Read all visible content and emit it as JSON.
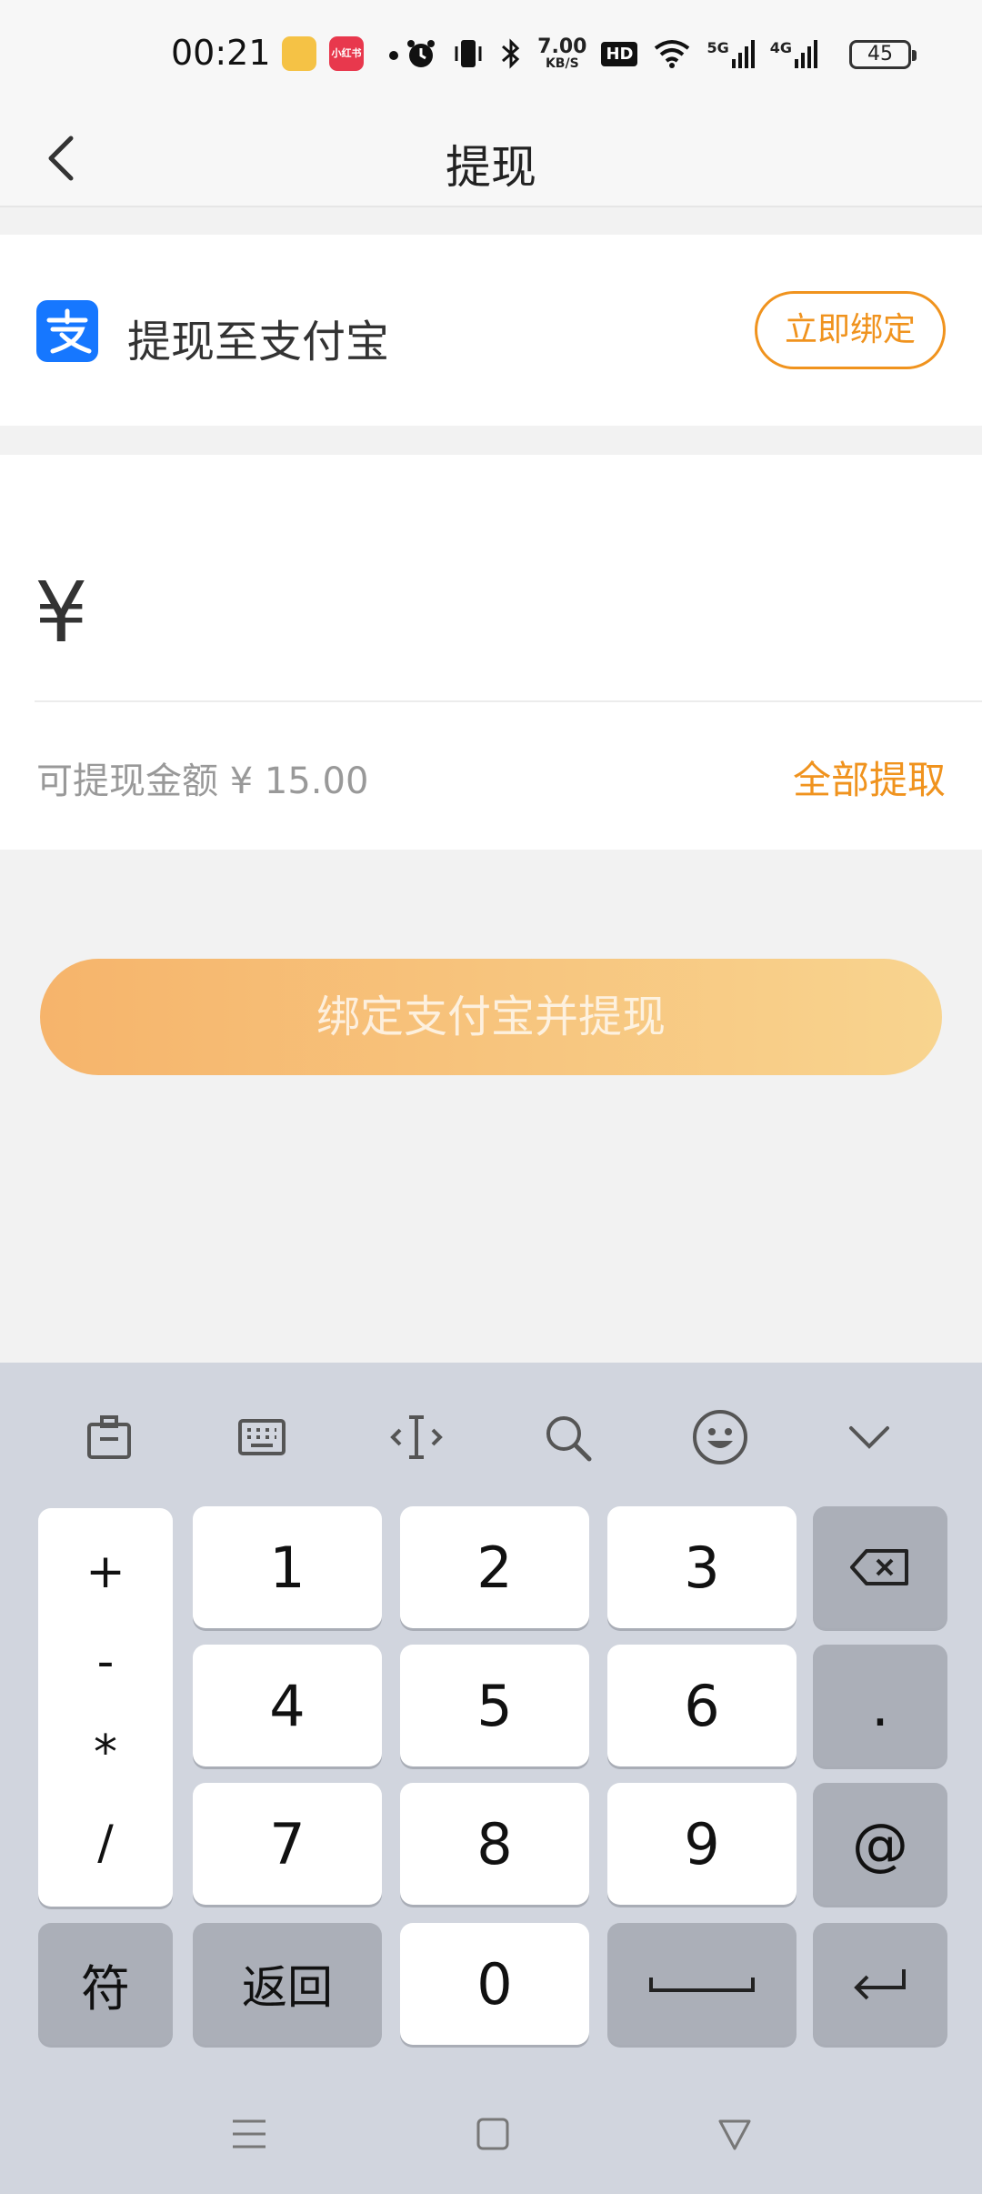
{
  "status_bar": {
    "time": "00:21",
    "xhs_label": "小红书",
    "speed_value": "7.00",
    "speed_unit": "KB/S",
    "hd_label": "HD",
    "net_5g": "5G",
    "net_4g": "4G",
    "battery": "45"
  },
  "header": {
    "title": "提现",
    "back_icon": "chevron-left-icon"
  },
  "alipay": {
    "label": "提现至支付宝",
    "bind_button": "立即绑定",
    "logo_glyph": "支",
    "brand_color": "#1677ff"
  },
  "amount": {
    "currency": "¥",
    "value": "",
    "available_label": "可提现金额 ¥ 15.00",
    "withdraw_all": "全部提取"
  },
  "action": {
    "label": "绑定支付宝并提现",
    "accent_color": "#f0931e"
  },
  "keyboard": {
    "toolbar": [
      "clipboard-icon",
      "keyboard-icon",
      "cursor-icon",
      "search-icon",
      "emoji-icon",
      "collapse-icon"
    ],
    "symbols": [
      "+",
      "-",
      "*",
      "/"
    ],
    "digits": [
      "1",
      "2",
      "3",
      "4",
      "5",
      "6",
      "7",
      "8",
      "9",
      "0"
    ],
    "dot": ".",
    "at": "@",
    "fu": "符",
    "back": "返回"
  }
}
